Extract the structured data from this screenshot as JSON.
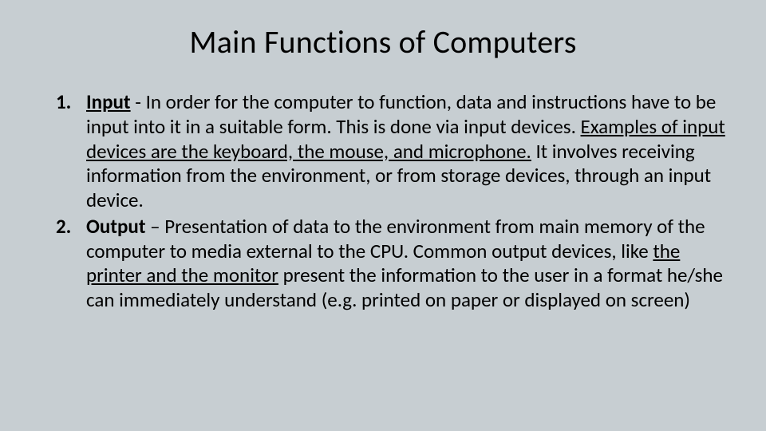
{
  "title": "Main Functions of Computers",
  "items": [
    {
      "term": "Input",
      "sep": " - ",
      "pre": "In order for the computer to function, data and instructions have to be input into it in a suitable form. This is done via input devices. ",
      "ul": "Examples of input devices are the keyboard, the mouse, and microphone.",
      "post": " It involves receiving information from the environment, or from storage devices, through an input device."
    },
    {
      "term": "Output",
      "sep": " – ",
      "pre": "Presentation of data to the environment from main memory of the computer to media external to the CPU. Common output devices, like ",
      "ul": "the printer and the monitor",
      "post": " present the information to the user in a format he/she can immediately understand (e.g. printed on paper or displayed on screen)"
    }
  ]
}
